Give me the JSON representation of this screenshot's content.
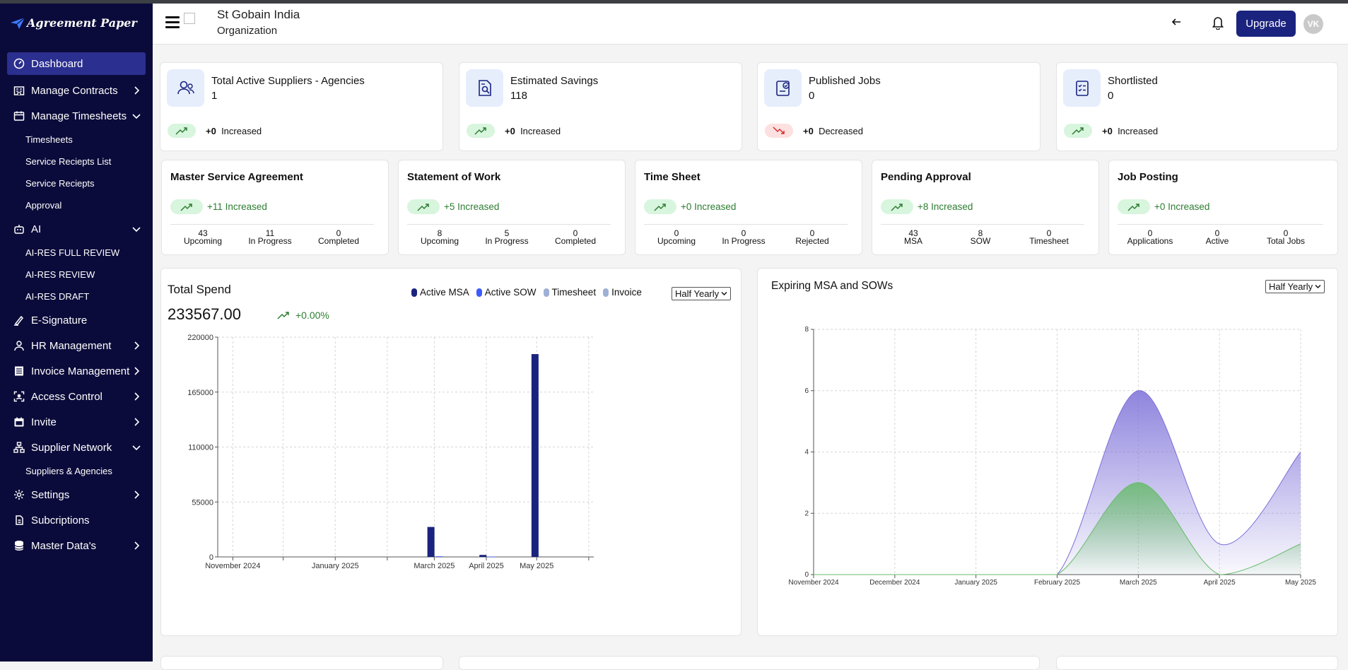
{
  "app": {
    "logo_text": "Agreement Paper"
  },
  "sidebar": {
    "items": [
      {
        "label": "Dashboard"
      },
      {
        "label": "Manage Contracts"
      },
      {
        "label": "Manage Timesheets"
      },
      {
        "label": "Timesheets"
      },
      {
        "label": "Service Reciepts List"
      },
      {
        "label": "Service Reciepts"
      },
      {
        "label": "Approval"
      },
      {
        "label": "AI"
      },
      {
        "label": "AI-RES FULL REVIEW"
      },
      {
        "label": "AI-RES REVIEW"
      },
      {
        "label": "AI-RES DRAFT"
      },
      {
        "label": "E-Signature"
      },
      {
        "label": "HR Management"
      },
      {
        "label": "Invoice Management"
      },
      {
        "label": "Access Control"
      },
      {
        "label": "Invite"
      },
      {
        "label": "Supplier Network"
      },
      {
        "label": "Suppliers & Agencies"
      },
      {
        "label": "Settings"
      },
      {
        "label": "Subcriptions"
      },
      {
        "label": "Master Data's"
      }
    ]
  },
  "header": {
    "org_name": "St Gobain India",
    "org_type": "Organization",
    "upgrade_label": "Upgrade",
    "avatar_initials": "VK"
  },
  "stats": [
    {
      "title": "Total Active Suppliers - Agencies",
      "value": "1",
      "delta": "+0",
      "direction": "Increased"
    },
    {
      "title": "Estimated Savings",
      "value": "118",
      "delta": "+0",
      "direction": "Increased"
    },
    {
      "title": "Published Jobs",
      "value": "0",
      "delta": "+0",
      "direction": "Decreased"
    },
    {
      "title": "Shortlisted",
      "value": "0",
      "delta": "+0",
      "direction": "Increased"
    }
  ],
  "summaries": [
    {
      "title": "Master Service Agreement",
      "trend": "+11 Increased",
      "cols": [
        {
          "value": "43",
          "label": "Upcoming"
        },
        {
          "value": "11",
          "label": "In Progress"
        },
        {
          "value": "0",
          "label": "Completed"
        }
      ]
    },
    {
      "title": "Statement of Work",
      "trend": "+5 Increased",
      "cols": [
        {
          "value": "8",
          "label": "Upcoming"
        },
        {
          "value": "5",
          "label": "In Progress"
        },
        {
          "value": "0",
          "label": "Completed"
        }
      ]
    },
    {
      "title": "Time Sheet",
      "trend": "+0 Increased",
      "cols": [
        {
          "value": "0",
          "label": "Upcoming"
        },
        {
          "value": "0",
          "label": "In Progress"
        },
        {
          "value": "0",
          "label": "Rejected"
        }
      ]
    },
    {
      "title": "Pending Approval",
      "trend": "+8 Increased",
      "cols": [
        {
          "value": "43",
          "label": "MSA"
        },
        {
          "value": "8",
          "label": "SOW"
        },
        {
          "value": "0",
          "label": "Timesheet"
        }
      ]
    },
    {
      "title": "Job Posting",
      "trend": "+0 Increased",
      "cols": [
        {
          "value": "0",
          "label": "Applications"
        },
        {
          "value": "0",
          "label": "Active"
        },
        {
          "value": "0",
          "label": "Total Jobs"
        }
      ]
    }
  ],
  "spend": {
    "title": "Total Spend",
    "total": "233567.00",
    "change": "+0.00%",
    "period": "Half Yearly"
  },
  "expiring": {
    "title": "Expiring MSA and SOWs",
    "period": "Half Yearly"
  },
  "colors": {
    "brand": "#1a237e",
    "sidebar": "#0b0b3b",
    "success": "#2e7d32",
    "danger": "#d32f2f"
  },
  "chart_data": [
    {
      "type": "bar",
      "title": "Total Spend",
      "series": [
        {
          "name": "Active MSA",
          "color": "#1a237e",
          "points": [
            {
              "x": "2025-02-27",
              "y": 30000
            },
            {
              "x": "2025-03-30",
              "y": 2000
            },
            {
              "x": "2025-04-30",
              "y": 203000
            }
          ]
        },
        {
          "name": "Active SOW",
          "color": "#3d5afe",
          "points": [
            {
              "x": "2025-03-04",
              "y": 600
            },
            {
              "x": "2025-04-04",
              "y": 300
            }
          ]
        },
        {
          "name": "Timesheet",
          "color": "#9fb0d6",
          "points": []
        },
        {
          "name": "Invoice",
          "color": "#9fb0d6",
          "points": []
        }
      ],
      "x_ticks": [
        "November 2024",
        "January 2025",
        "March 2025",
        "April 2025",
        "May 2025"
      ],
      "ylim": [
        0,
        220000
      ],
      "y_ticks": [
        0,
        55000,
        110000,
        165000,
        220000
      ],
      "grid": true,
      "legend": "top-right"
    },
    {
      "type": "area",
      "title": "Expiring MSA and SOWs",
      "categories": [
        "November 2024",
        "December 2024",
        "January 2025",
        "February 2025",
        "March 2025",
        "April 2025",
        "May 2025"
      ],
      "series": [
        {
          "name": "",
          "color": "#7b6fd8",
          "values": [
            0,
            0,
            0,
            0,
            6,
            1,
            4
          ]
        },
        {
          "name": "",
          "color": "#66bb6a",
          "values": [
            0,
            0,
            0,
            0,
            3,
            0,
            1
          ]
        }
      ],
      "ylim": [
        0,
        8
      ],
      "y_ticks": [
        0,
        2,
        4,
        6,
        8
      ],
      "grid": true
    }
  ]
}
